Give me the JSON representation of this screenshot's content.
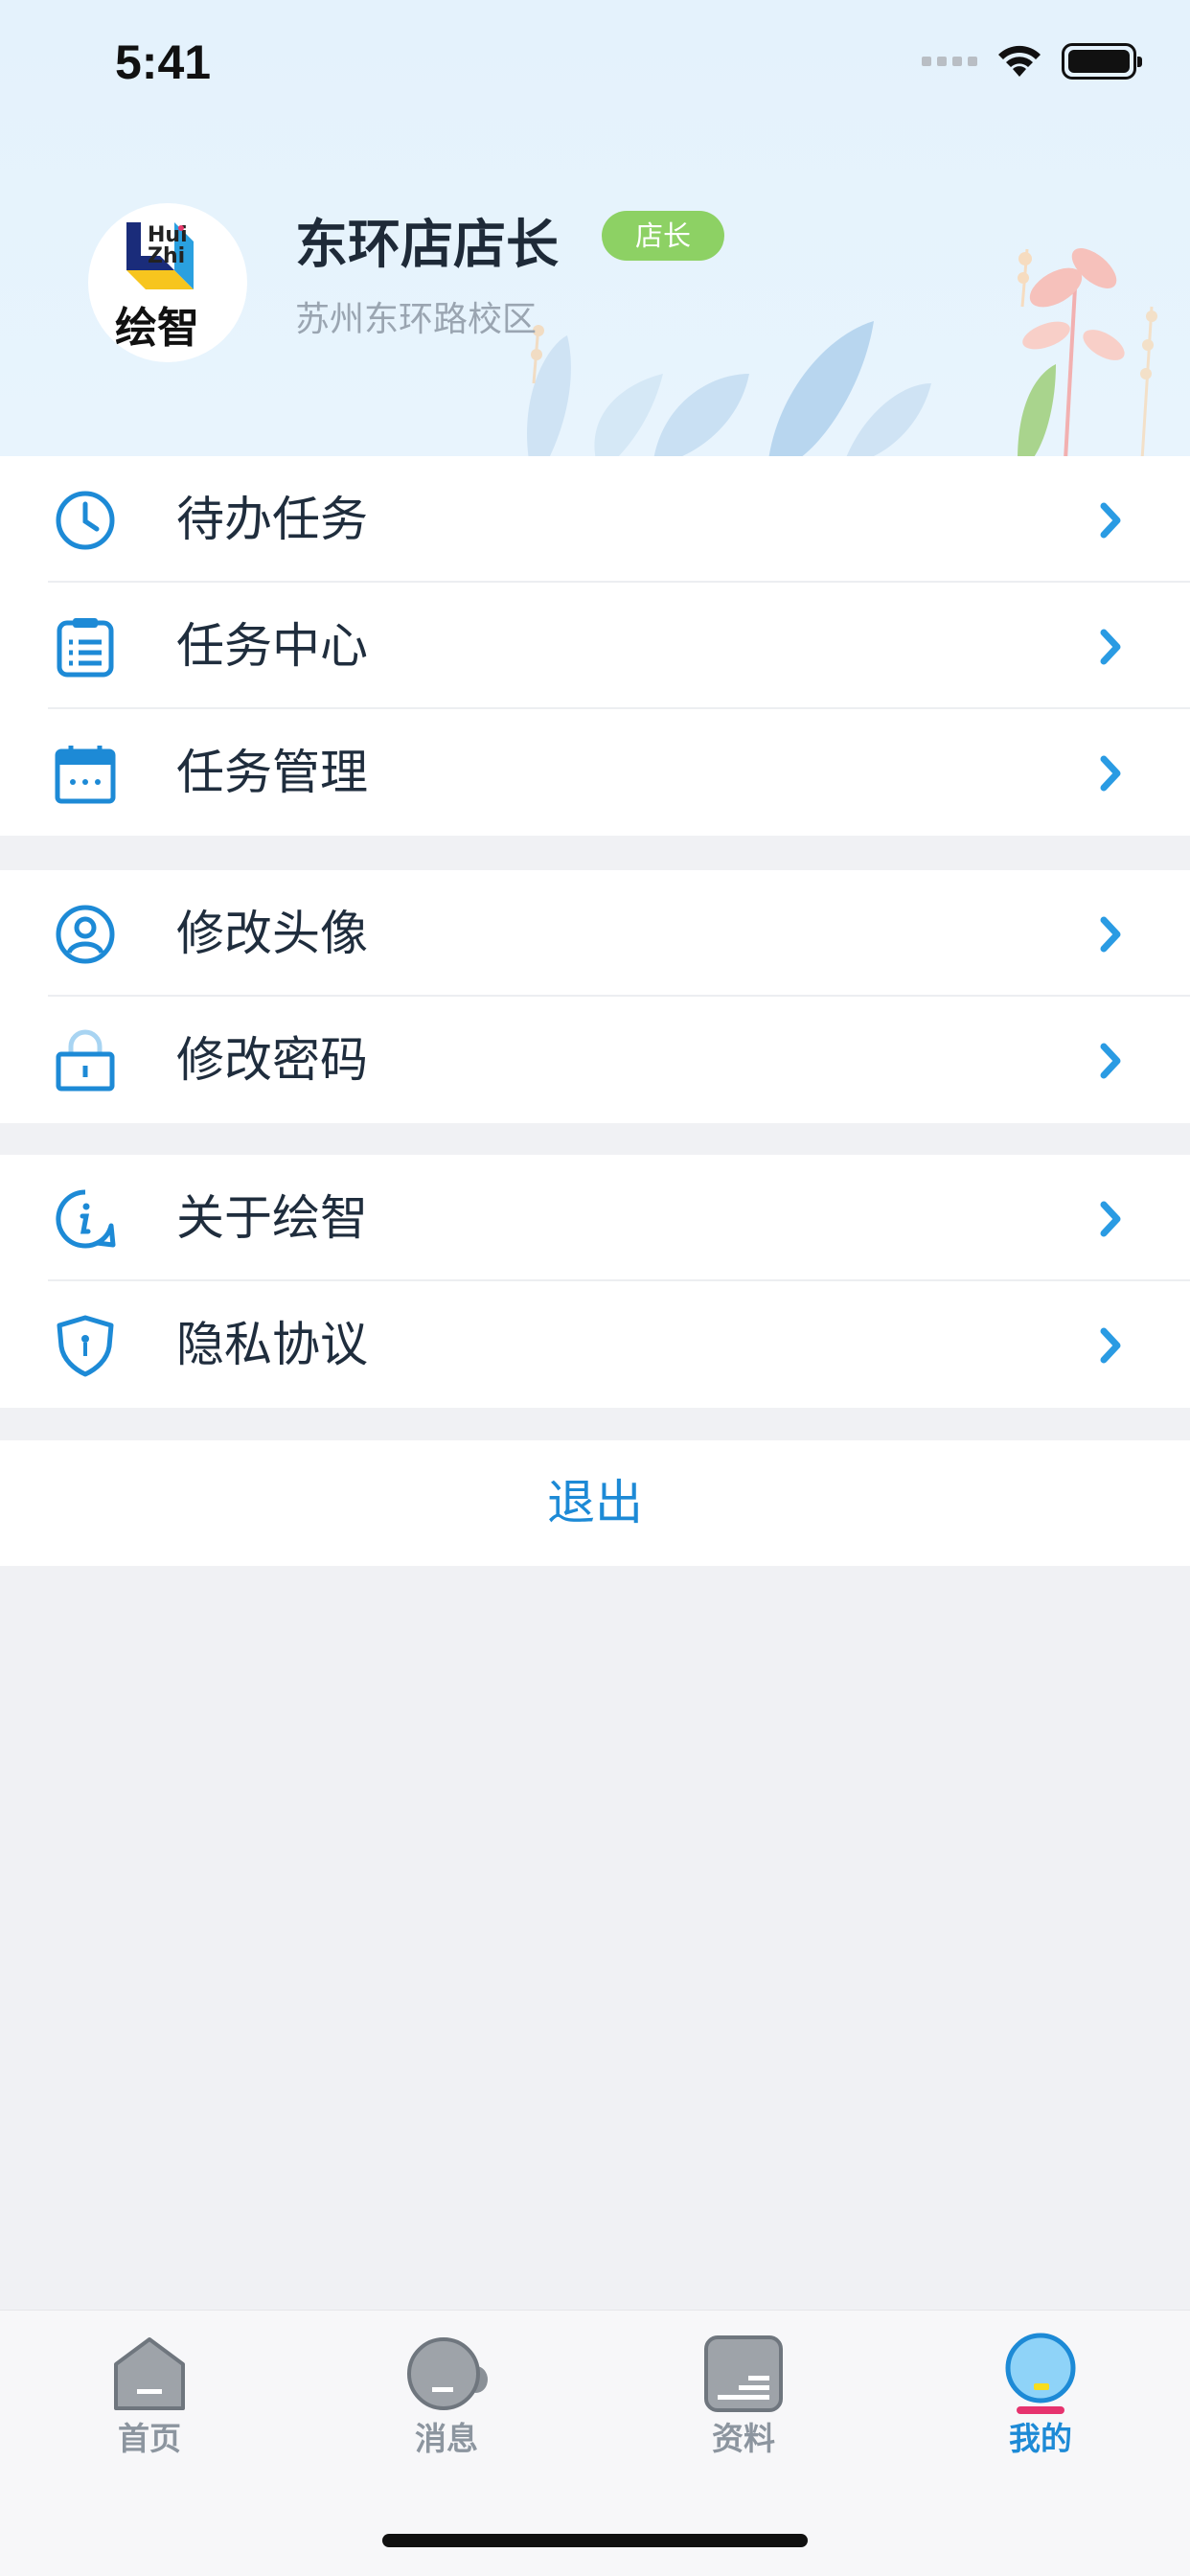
{
  "status_bar": {
    "time": "5:41"
  },
  "profile": {
    "name": "东环店店长",
    "role_badge": "店长",
    "campus": "苏州东环路校区",
    "logo_text": "Hui Zhi 绘智"
  },
  "menu": {
    "group1": [
      {
        "label": "待办任务",
        "icon": "clock-icon"
      },
      {
        "label": "任务中心",
        "icon": "clipboard-icon"
      },
      {
        "label": "任务管理",
        "icon": "calendar-icon"
      }
    ],
    "group2": [
      {
        "label": "修改头像",
        "icon": "user-avatar-icon"
      },
      {
        "label": "修改密码",
        "icon": "lock-icon"
      }
    ],
    "group3": [
      {
        "label": "关于绘智",
        "icon": "info-icon"
      },
      {
        "label": "隐私协议",
        "icon": "shield-icon"
      }
    ]
  },
  "logout_label": "退出",
  "tabs": [
    {
      "label": "首页",
      "icon": "home-icon",
      "active": false
    },
    {
      "label": "消息",
      "icon": "message-icon",
      "active": false
    },
    {
      "label": "资料",
      "icon": "document-icon",
      "active": false
    },
    {
      "label": "我的",
      "icon": "profile-icon",
      "active": true
    }
  ],
  "colors": {
    "accent": "#1d8ad6",
    "badge": "#8dd164",
    "header_bg": "#e6f3fc"
  }
}
